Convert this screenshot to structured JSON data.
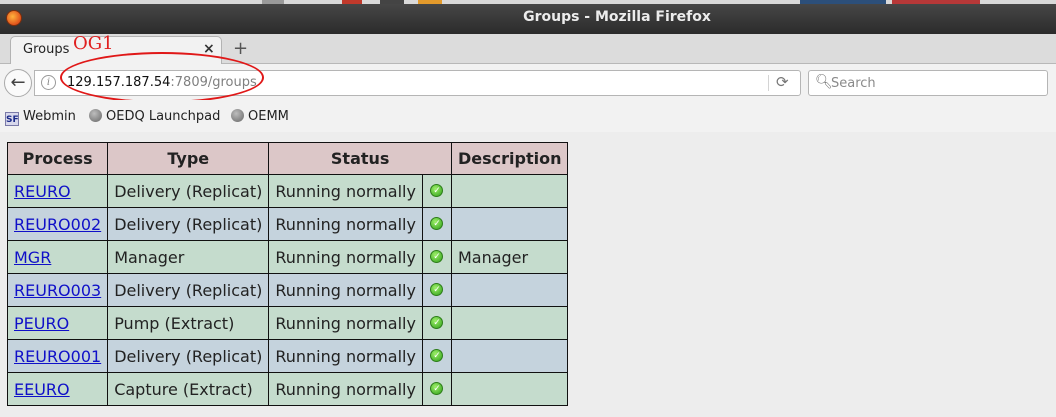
{
  "window": {
    "title": "Groups - Mozilla Firefox"
  },
  "tab": {
    "label": "Groups",
    "close": "×",
    "new_tab": "+"
  },
  "annotation": {
    "label": "OG1",
    "color": "#e02020"
  },
  "nav": {
    "back": "←",
    "url_host": "129.157.187.54",
    "url_rest": ":7809/groups",
    "reload": "⟳",
    "search_placeholder": "Search"
  },
  "bookmarks": [
    {
      "label": "Webmin",
      "icon": "sf-icon",
      "icon_text": "SF"
    },
    {
      "label": "OEDQ Launchpad",
      "icon": "globe-icon"
    },
    {
      "label": "OEMM",
      "icon": "globe-icon"
    }
  ],
  "table": {
    "headers": {
      "process": "Process",
      "type": "Type",
      "status": "Status",
      "description": "Description"
    },
    "colors": {
      "header": "#dcc7c8",
      "row_green": "#c5dccd",
      "row_blue": "#c5d3dd",
      "link": "#1010c8"
    },
    "rows": [
      {
        "process": "REURO",
        "type": "Delivery (Replicat)",
        "status": "Running normally",
        "status_icon": "check-ok-icon",
        "description": ""
      },
      {
        "process": "REURO002",
        "type": "Delivery (Replicat)",
        "status": "Running normally",
        "status_icon": "check-ok-icon",
        "description": ""
      },
      {
        "process": "MGR",
        "type": "Manager",
        "status": "Running normally",
        "status_icon": "check-ok-icon",
        "description": "Manager"
      },
      {
        "process": "REURO003",
        "type": "Delivery (Replicat)",
        "status": "Running normally",
        "status_icon": "check-ok-icon",
        "description": ""
      },
      {
        "process": "PEURO",
        "type": "Pump (Extract)",
        "status": "Running normally",
        "status_icon": "check-ok-icon",
        "description": ""
      },
      {
        "process": "REURO001",
        "type": "Delivery (Replicat)",
        "status": "Running normally",
        "status_icon": "check-ok-icon",
        "description": ""
      },
      {
        "process": "EEURO",
        "type": "Capture (Extract)",
        "status": "Running normally",
        "status_icon": "check-ok-icon",
        "description": ""
      }
    ]
  }
}
